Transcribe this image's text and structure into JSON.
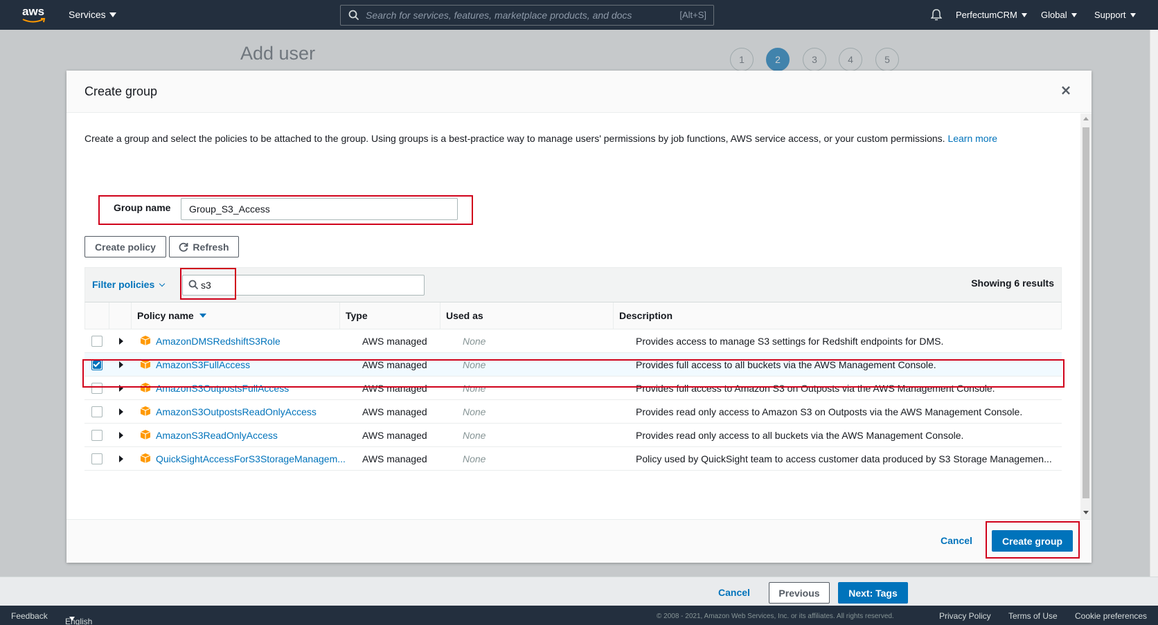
{
  "topnav": {
    "logo_text": "aws",
    "services_label": "Services",
    "search_placeholder": "Search for services, features, marketplace products, and docs",
    "search_hint": "[Alt+S]",
    "account": "PerfectumCRM",
    "region": "Global",
    "support": "Support",
    "icons": [
      "search-icon",
      "bell-icon"
    ]
  },
  "page": {
    "title": "Add user",
    "steps": [
      "1",
      "2",
      "3",
      "4",
      "5"
    ],
    "active_step": "2"
  },
  "modal": {
    "title": "Create group",
    "close_label": "×",
    "intro_text": "Create a group and select the policies to be attached to the group. Using groups is a best-practice way to manage users' permissions by job functions, AWS service access, or your custom permissions.",
    "learn_more": "Learn more",
    "group_name_label": "Group name",
    "group_name_value": "Group_S3_Access",
    "create_policy_label": "Create policy",
    "refresh_label": "Refresh",
    "filter_label": "Filter policies",
    "search_value": "s3",
    "showing": "Showing 6 results",
    "columns": [
      "Policy name",
      "Type",
      "Used as",
      "Description"
    ],
    "rows": [
      {
        "name": "AmazonDMSRedshiftS3Role",
        "type": "AWS managed",
        "used_as": "None",
        "description": "Provides access to manage S3 settings for Redshift endpoints for DMS.",
        "checked": false
      },
      {
        "name": "AmazonS3FullAccess",
        "type": "AWS managed",
        "used_as": "None",
        "description": "Provides full access to all buckets via the AWS Management Console.",
        "checked": true
      },
      {
        "name": "AmazonS3OutpostsFullAccess",
        "type": "AWS managed",
        "used_as": "None",
        "description": "Provides full access to Amazon S3 on Outposts via the AWS Management Console.",
        "checked": false
      },
      {
        "name": "AmazonS3OutpostsReadOnlyAccess",
        "type": "AWS managed",
        "used_as": "None",
        "description": "Provides read only access to Amazon S3 on Outposts via the AWS Management Console.",
        "checked": false
      },
      {
        "name": "AmazonS3ReadOnlyAccess",
        "type": "AWS managed",
        "used_as": "None",
        "description": "Provides read only access to all buckets via the AWS Management Console.",
        "checked": false
      },
      {
        "name": "QuickSightAccessForS3StorageManagem...",
        "type": "AWS managed",
        "used_as": "None",
        "description": "Policy used by QuickSight team to access customer data produced by S3 Storage Managemen...",
        "checked": false
      }
    ],
    "cancel_label": "Cancel",
    "create_group_label": "Create group"
  },
  "bottombar": {
    "cancel": "Cancel",
    "previous": "Previous",
    "next": "Next: Tags"
  },
  "footer": {
    "feedback": "Feedback",
    "language": "English (US)",
    "copyright": "© 2008 - 2021, Amazon Web Services, Inc. or its affiliates. All rights reserved.",
    "privacy": "Privacy Policy",
    "terms": "Terms of Use",
    "cookies": "Cookie preferences"
  },
  "colors": {
    "nav_bg": "#232f3e",
    "accent": "#0073bb",
    "highlight": "#d0021b",
    "policy_icon": "#f90"
  }
}
